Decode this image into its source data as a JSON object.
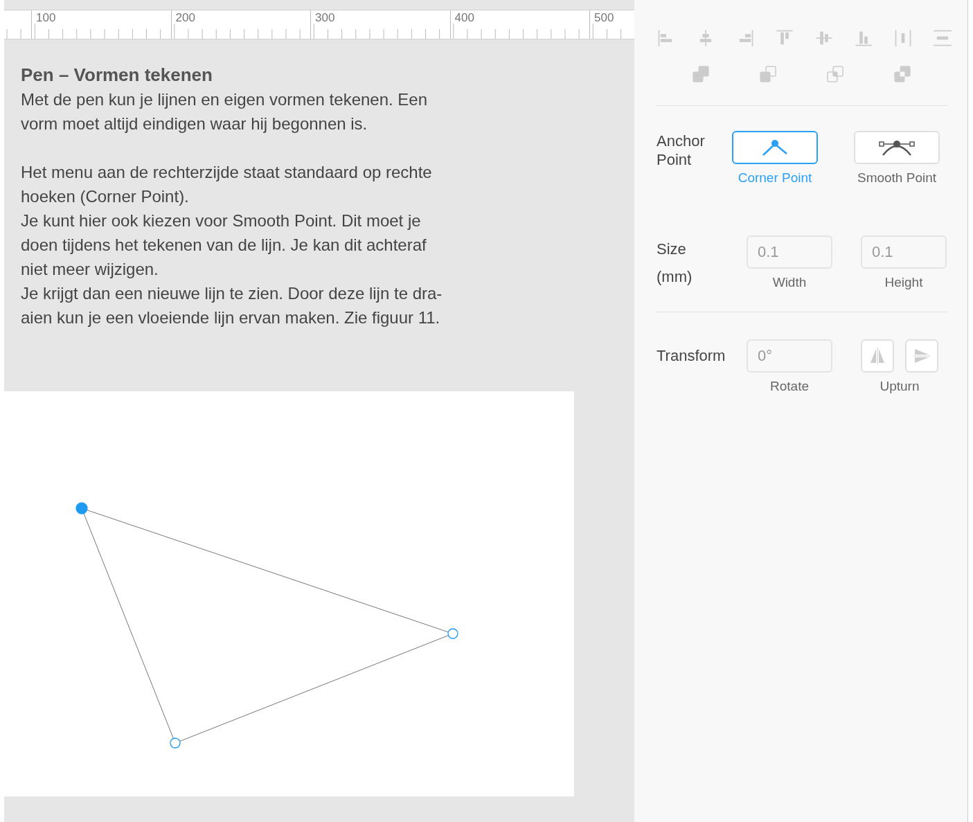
{
  "ruler": {
    "labels": [
      "100",
      "200",
      "300",
      "400",
      "500"
    ]
  },
  "instructions": {
    "title": "Pen – Vormen tekenen",
    "paragraphs": [
      [
        "Met de pen kun je lijnen en eigen vormen tekenen. Een",
        "vorm moet altijd eindigen waar hij begonnen is."
      ],
      [
        "Het menu aan de rechterzijde staat standaard op rechte",
        "hoeken (Corner Point)."
      ],
      [
        "Je kunt hier ook kiezen voor Smooth Point. Dit moet je",
        "doen tijdens het tekenen van de lijn. Je kan dit achteraf",
        "niet meer wijzigen."
      ],
      [
        "Je krijgt dan een nieuwe lijn te zien. Door deze lijn te dra-",
        "aien kun je een vloeiende lijn ervan maken. Zie figuur 11."
      ]
    ]
  },
  "canvas": {
    "points": [
      {
        "selected": true
      },
      {
        "selected": false
      },
      {
        "selected": false
      }
    ]
  },
  "panel": {
    "anchor_point": {
      "label": "Anchor Point",
      "options": [
        {
          "kind": "corner",
          "label": "Corner Point",
          "selected": true
        },
        {
          "kind": "smooth",
          "label": "Smooth Point",
          "selected": false
        }
      ]
    },
    "size": {
      "label_lines": [
        "Size",
        "(mm)"
      ],
      "fields": [
        {
          "placeholder": "0.1",
          "caption": "Width"
        },
        {
          "placeholder": "0.1",
          "caption": "Height"
        }
      ]
    },
    "transform": {
      "label": "Transform",
      "rotate": {
        "placeholder": "0°",
        "caption": "Rotate"
      },
      "upturn": {
        "caption": "Upturn"
      }
    }
  }
}
